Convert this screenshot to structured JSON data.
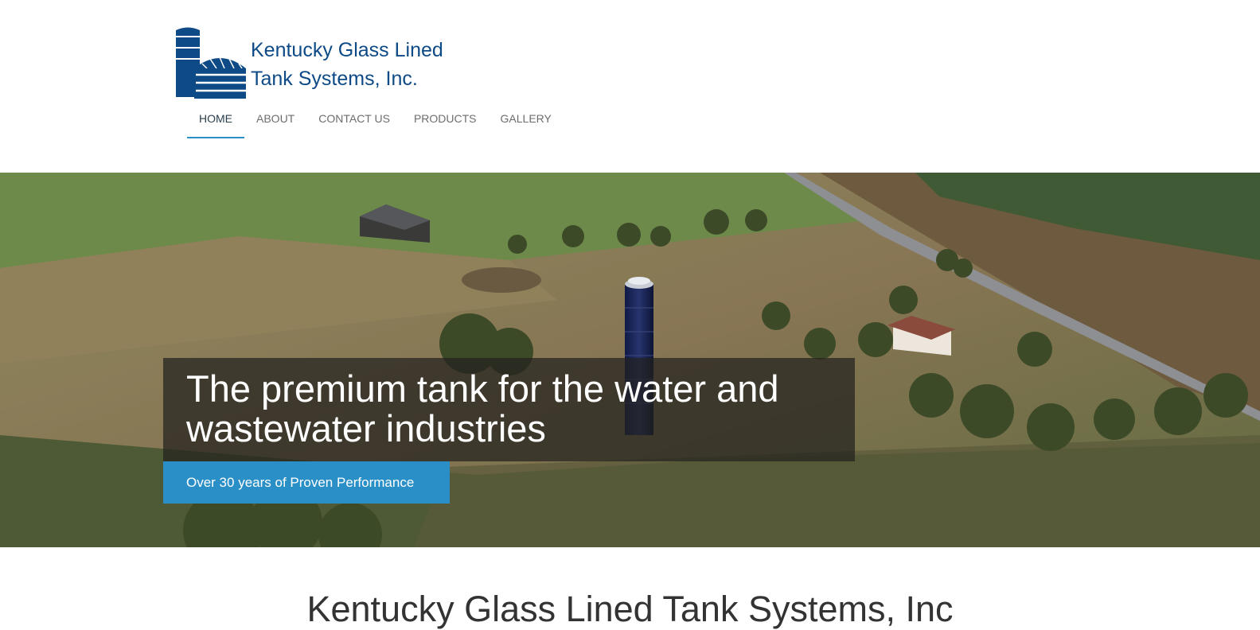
{
  "brand": {
    "line1": "Kentucky Glass Lined",
    "line2": "Tank Systems, Inc.",
    "color": "#0d4a86"
  },
  "nav": {
    "items": [
      {
        "label": "HOME",
        "active": true
      },
      {
        "label": "ABOUT",
        "active": false
      },
      {
        "label": "CONTACT US",
        "active": false
      },
      {
        "label": "PRODUCTS",
        "active": false
      },
      {
        "label": "GALLERY",
        "active": false
      }
    ],
    "accent": "#2a8fc7"
  },
  "hero": {
    "headline": "The premium tank for the water and wastewater industries",
    "tagline": "Over 30 years of Proven Performance",
    "image_description_icon": "aerial-farm-photo"
  },
  "section": {
    "title": "Kentucky Glass Lined Tank Systems, Inc"
  }
}
